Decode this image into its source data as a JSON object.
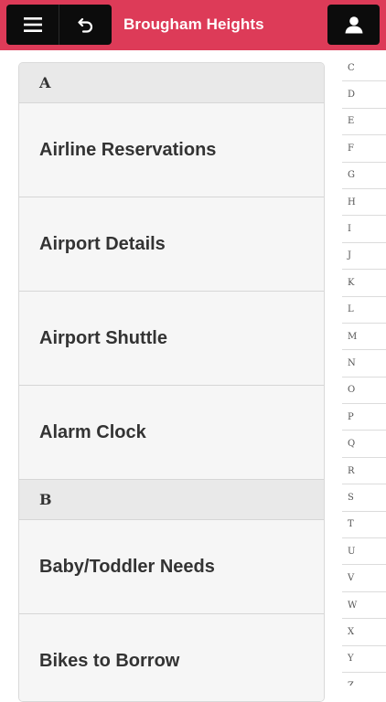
{
  "header": {
    "title": "Brougham Heights",
    "menu_icon": "hamburger-menu-icon",
    "back_icon": "undo-arrow-icon",
    "user_icon": "user-silhouette-icon",
    "bar_color": "#dd3b58"
  },
  "sections": [
    {
      "letter": "A",
      "items": [
        "Airline Reservations",
        "Airport Details",
        "Airport Shuttle",
        "Alarm Clock"
      ]
    },
    {
      "letter": "B",
      "items": [
        "Baby/Toddler Needs",
        "Bikes to Borrow"
      ]
    }
  ],
  "index_letters": [
    "C",
    "D",
    "E",
    "F",
    "G",
    "H",
    "I",
    "J",
    "K",
    "L",
    "M",
    "N",
    "O",
    "P",
    "Q",
    "R",
    "S",
    "T",
    "U",
    "V",
    "W",
    "X",
    "Y",
    "Z"
  ]
}
